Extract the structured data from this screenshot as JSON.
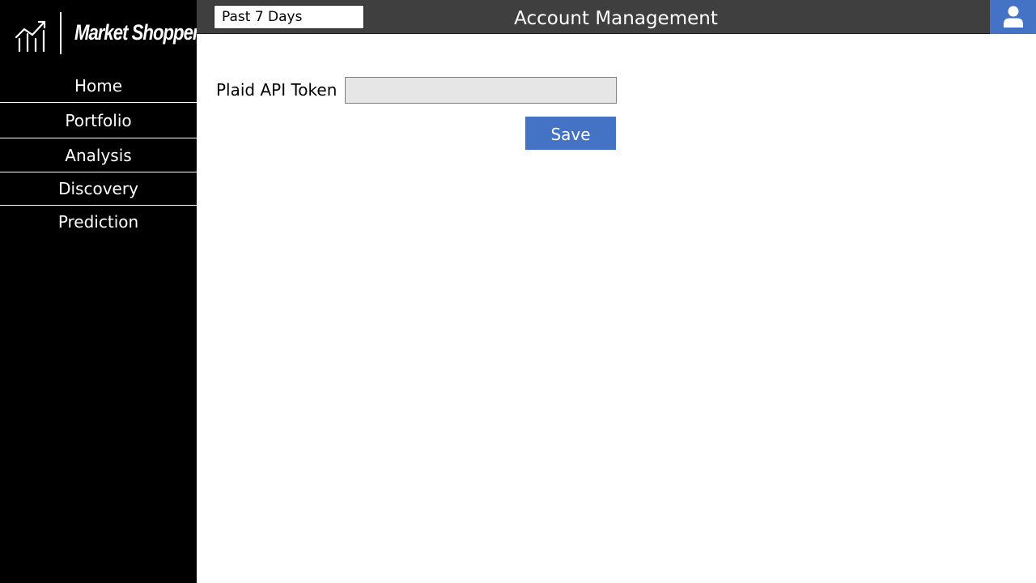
{
  "brand": {
    "name": "Market Shopper",
    "logo_icon": "chart-growth-icon"
  },
  "sidebar": {
    "items": [
      {
        "label": "Home"
      },
      {
        "label": "Portfolio"
      },
      {
        "label": "Analysis"
      },
      {
        "label": "Discovery"
      },
      {
        "label": "Prediction"
      }
    ]
  },
  "header": {
    "range_select_value": "Past 7 Days",
    "title": "Account Management",
    "user_icon": "user-icon"
  },
  "form": {
    "token_label": "Plaid API Token",
    "token_value": "",
    "save_label": "Save"
  },
  "colors": {
    "sidebar_bg": "#000000",
    "topbar_bg": "#3f3f3f",
    "accent": "#4472c4",
    "input_bg": "#e6e6e6"
  }
}
